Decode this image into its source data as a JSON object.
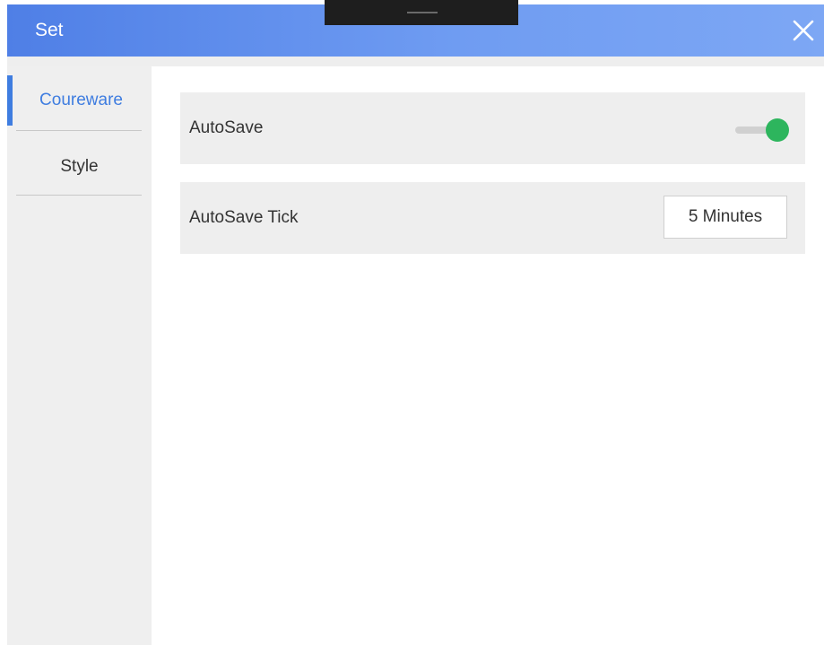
{
  "window": {
    "title": "Set",
    "close_icon": "close-icon",
    "colors": {
      "title_bar_start": "#4f7fe6",
      "title_bar_end": "#7da7f4",
      "accent": "#3f7de0",
      "toggle_on": "#2db55d"
    }
  },
  "sidebar": {
    "items": [
      {
        "label": "Coureware",
        "active": true
      },
      {
        "label": "Style",
        "active": false
      }
    ]
  },
  "settings": {
    "autosave": {
      "label": "AutoSave",
      "enabled": true
    },
    "autosave_tick": {
      "label": "AutoSave Tick",
      "value": "5 Minutes"
    }
  }
}
